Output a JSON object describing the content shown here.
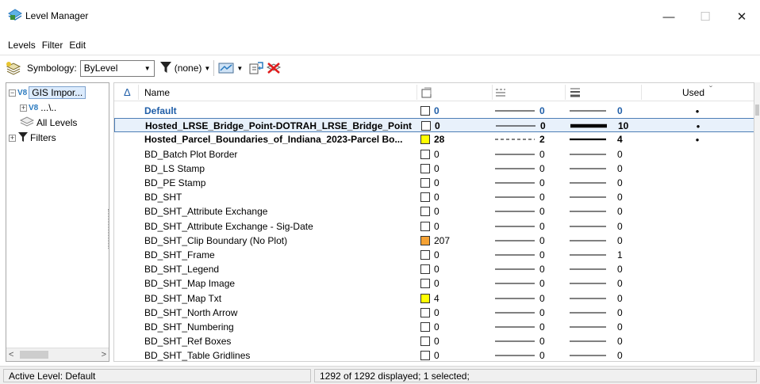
{
  "window": {
    "title": "Level Manager",
    "minimize": "—",
    "maximize": "☐",
    "close": "✕"
  },
  "menu": [
    "Levels",
    "Filter",
    "Edit"
  ],
  "toolbar": {
    "symbology_label": "Symbology:",
    "symbology_value": "ByLevel",
    "filter_value": "(none)"
  },
  "tree": {
    "root_label": "GIS Impor...",
    "child_label": "...\\..",
    "all_levels": "All Levels",
    "filters": "Filters"
  },
  "grid": {
    "columns": {
      "sort": "Δ",
      "name": "Name",
      "used": "Used",
      "used_sort": "ˇ"
    },
    "rows": [
      {
        "name": "Default",
        "color": "0",
        "swatch": "#ffffff",
        "style": "0",
        "weight": "0",
        "used": "•",
        "bold": true,
        "blue": true,
        "dashed": false
      },
      {
        "name": "Hosted_LRSE_Bridge_Point-DOTRAH_LRSE_Bridge_Point",
        "color": "0",
        "swatch": "#ffffff",
        "style": "0",
        "weight": "10",
        "used": "•",
        "bold": true,
        "selected": true,
        "thick": true
      },
      {
        "name": "Hosted_Parcel_Boundaries_of_Indiana_2023-Parcel Bo...",
        "color": "28",
        "swatch": "#ffff00",
        "style": "2",
        "weight": "4",
        "used": "•",
        "bold": true,
        "dashed": true,
        "medium": true
      },
      {
        "name": "BD_Batch Plot Border",
        "color": "0",
        "swatch": "#ffffff",
        "style": "0",
        "weight": "0",
        "used": ""
      },
      {
        "name": "BD_LS Stamp",
        "color": "0",
        "swatch": "#ffffff",
        "style": "0",
        "weight": "0",
        "used": ""
      },
      {
        "name": "BD_PE Stamp",
        "color": "0",
        "swatch": "#ffffff",
        "style": "0",
        "weight": "0",
        "used": ""
      },
      {
        "name": "BD_SHT",
        "color": "0",
        "swatch": "#ffffff",
        "style": "0",
        "weight": "0",
        "used": ""
      },
      {
        "name": "BD_SHT_Attribute Exchange",
        "color": "0",
        "swatch": "#ffffff",
        "style": "0",
        "weight": "0",
        "used": ""
      },
      {
        "name": "BD_SHT_Attribute Exchange - Sig-Date",
        "color": "0",
        "swatch": "#ffffff",
        "style": "0",
        "weight": "0",
        "used": ""
      },
      {
        "name": "BD_SHT_Clip Boundary (No Plot)",
        "color": "207",
        "swatch": "#f5a234",
        "style": "0",
        "weight": "0",
        "used": ""
      },
      {
        "name": "BD_SHT_Frame",
        "color": "0",
        "swatch": "#ffffff",
        "style": "0",
        "weight": "1",
        "used": ""
      },
      {
        "name": "BD_SHT_Legend",
        "color": "0",
        "swatch": "#ffffff",
        "style": "0",
        "weight": "0",
        "used": ""
      },
      {
        "name": "BD_SHT_Map Image",
        "color": "0",
        "swatch": "#ffffff",
        "style": "0",
        "weight": "0",
        "used": ""
      },
      {
        "name": "BD_SHT_Map Txt",
        "color": "4",
        "swatch": "#ffff00",
        "style": "0",
        "weight": "0",
        "used": ""
      },
      {
        "name": "BD_SHT_North Arrow",
        "color": "0",
        "swatch": "#ffffff",
        "style": "0",
        "weight": "0",
        "used": ""
      },
      {
        "name": "BD_SHT_Numbering",
        "color": "0",
        "swatch": "#ffffff",
        "style": "0",
        "weight": "0",
        "used": ""
      },
      {
        "name": "BD_SHT_Ref Boxes",
        "color": "0",
        "swatch": "#ffffff",
        "style": "0",
        "weight": "0",
        "used": ""
      },
      {
        "name": "BD_SHT_Table Gridlines",
        "color": "0",
        "swatch": "#ffffff",
        "style": "0",
        "weight": "0",
        "used": ""
      }
    ]
  },
  "status": {
    "active_level": "Active Level: Default",
    "summary": "1292 of 1292 displayed; 1 selected;"
  },
  "colors": {
    "selection_border": "#4d7eb6",
    "selection_fill": "#e8f1fb",
    "default_level_text": "#1f5ea8",
    "accent_icon": "#2a7abf"
  }
}
